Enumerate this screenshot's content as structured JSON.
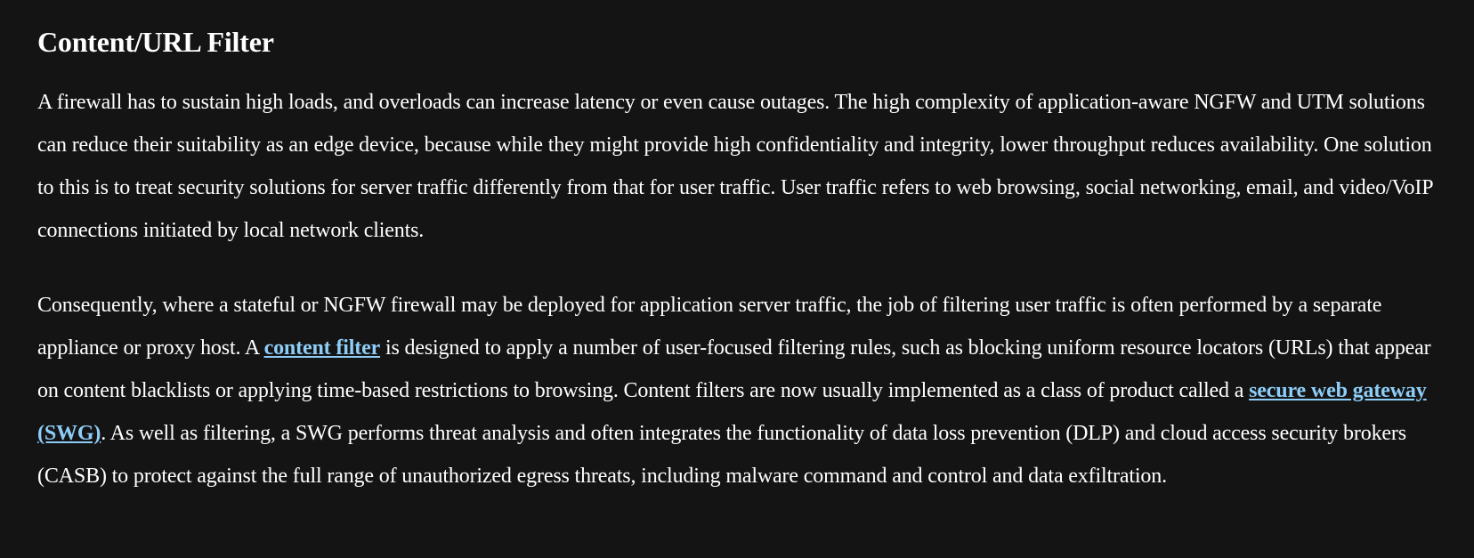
{
  "heading": "Content/URL Filter",
  "paragraph1": "A firewall has to sustain high loads, and overloads can increase latency or even cause outages. The high complexity of application-aware NGFW and UTM solutions can reduce their suitability as an edge device, because while they might provide high confidentiality and integrity, lower throughput reduces availability. One solution to this is to treat security solutions for server traffic differently from that for user traffic. User traffic refers to web browsing, social networking, email, and video/VoIP connections initiated by local network clients.",
  "paragraph2": {
    "text_before_link1": "Consequently, where a stateful or NGFW firewall may be deployed for application server traffic, the job of filtering user traffic is often performed by a separate appliance or proxy host. A ",
    "link1": "content filter",
    "text_after_link1": " is designed to apply a number of user-focused filtering rules, such as blocking uniform resource locators (URLs) that appear on content blacklists or applying time-based restrictions to browsing. Content filters are now usually implemented as a class of product called a ",
    "link2": "secure web gateway (SWG)",
    "text_after_link2": ". As well as filtering, a SWG performs threat analysis and often integrates the functionality of data loss prevention (DLP) and cloud access security brokers (CASB) to protect against the full range of unauthorized egress threats, including malware command and control and data exfiltration."
  },
  "colors": {
    "background": "#141414",
    "text": "#ffffff",
    "link": "#8ecdf7"
  }
}
